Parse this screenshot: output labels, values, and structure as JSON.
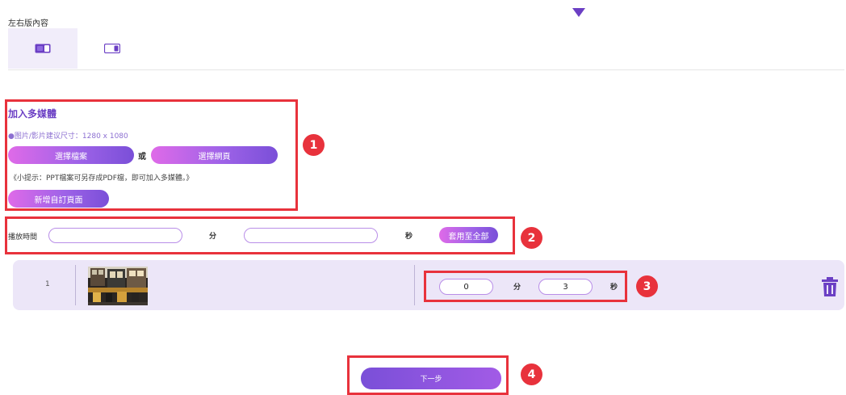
{
  "layout_section": {
    "title": "左右版內容",
    "tabs": [
      {
        "name": "text-left-layout"
      },
      {
        "name": "text-right-layout"
      }
    ]
  },
  "media": {
    "title": "加入多媒體",
    "size_hint": "●图片/影片建议尺寸：1280 x 1080",
    "choose_file_label": "選擇檔案",
    "or_label": "或",
    "choose_web_label": "選擇網頁",
    "tip": "《小提示：PPT檔案可另存成PDF檔，即可加入多媒體。》",
    "add_custom_page_label": "新增自訂頁面"
  },
  "playtime": {
    "label": "播放時間",
    "minutes_value": "",
    "minutes_unit": "分",
    "seconds_value": "",
    "seconds_unit": "秒",
    "apply_all_label": "套用至全部"
  },
  "slide_row": {
    "index": "1",
    "minutes_value": "0",
    "minutes_unit": "分",
    "seconds_value": "3",
    "seconds_unit": "秒"
  },
  "next_label": "下一步",
  "badges": [
    "1",
    "2",
    "3",
    "4"
  ],
  "colors": {
    "accent": "#6b3fc4",
    "pill_gradient_start": "#df6ae8",
    "pill_gradient_end": "#7a4fd8",
    "annotation_red": "#e8323c",
    "row_bg": "#ece6f8"
  }
}
